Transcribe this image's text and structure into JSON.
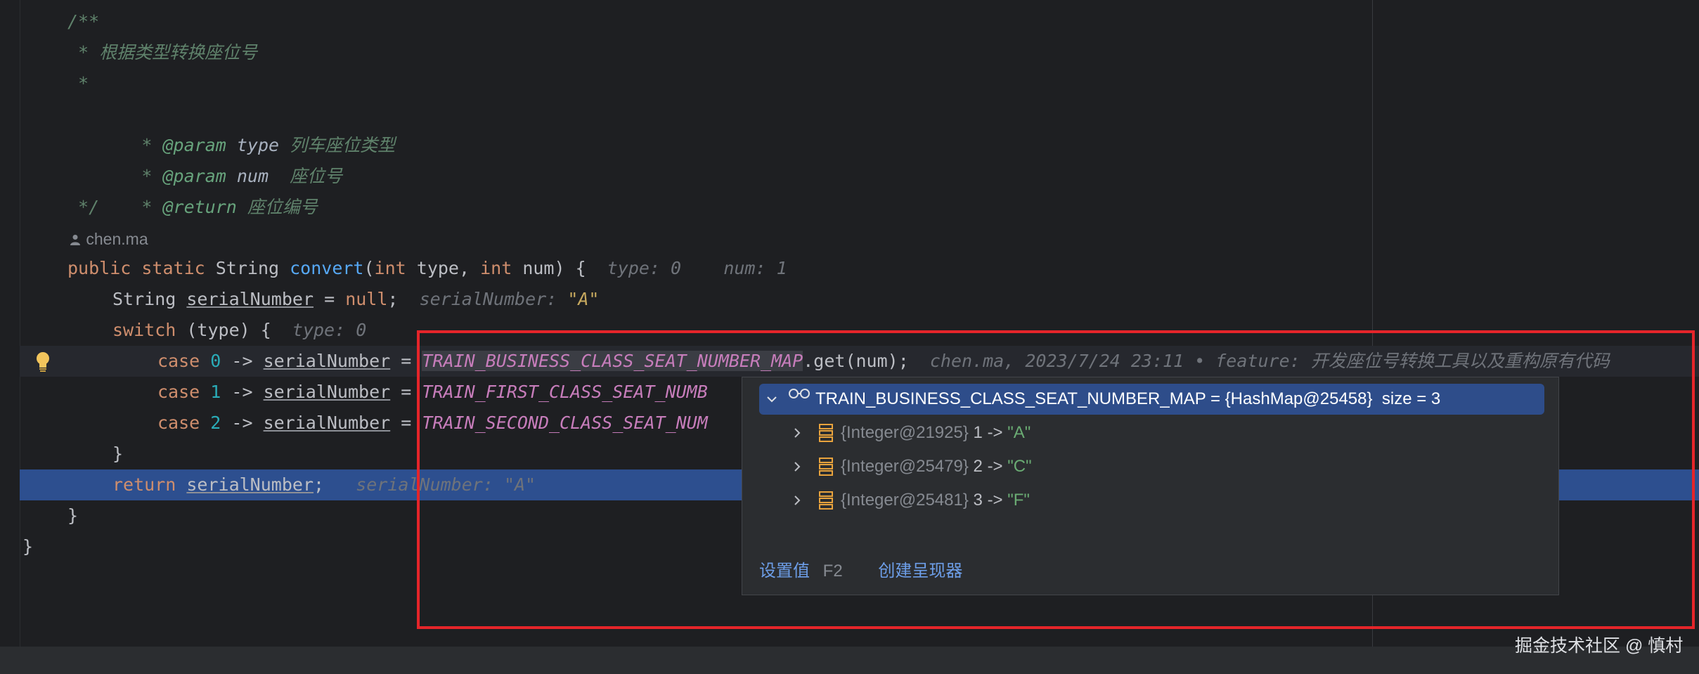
{
  "code": {
    "doc_open": "/**",
    "doc_desc": " * 根据类型转换座位号",
    "doc_blank": " *",
    "doc_param1_prefix": " * ",
    "doc_param1_tag": "@param",
    "doc_param1_name": "type",
    "doc_param1_desc": "列车座位类型",
    "doc_param2_prefix": " * ",
    "doc_param2_tag": "@param",
    "doc_param2_name": "num",
    "doc_param2_desc": "座位号",
    "doc_return_prefix": " * ",
    "doc_return_tag": "@return",
    "doc_return_desc": "座位编号",
    "doc_close": " */",
    "author": "chen.ma",
    "sig_public": "public",
    "sig_static": "static",
    "sig_type": "String",
    "sig_name": "convert",
    "sig_paren_open": "(",
    "sig_int1": "int",
    "sig_param1": "type,",
    "sig_int2": "int",
    "sig_param2": "num) {",
    "sig_hint1": "type: 0",
    "sig_hint2": "num: 1",
    "decl_type": "String",
    "decl_var": "serialNumber",
    "decl_eq": "=",
    "decl_null": "null",
    "decl_semi": ";",
    "decl_hint_label": "serialNumber:",
    "decl_hint_value": "\"A\"",
    "switch_kw": "switch",
    "switch_rest": "(type) {",
    "switch_hint": "type: 0",
    "case_kw": "case",
    "arrow": "->",
    "assign": "=",
    "case0_num": "0",
    "case1_num": "1",
    "case2_num": "2",
    "case_var": "serialNumber",
    "case0_field": "TRAIN_BUSINESS_CLASS_SEAT_NUMBER_MAP",
    "case0_call": ".get(num);",
    "case1_field": "TRAIN_FIRST_CLASS_SEAT_NUMB",
    "case2_field": "TRAIN_SECOND_CLASS_SEAT_NUM",
    "blame": "chen.ma, 2023/7/24 23:11 • feature: 开发座位号转换工具以及重构原有代码",
    "close_switch": "}",
    "return_kw": "return",
    "return_var": "serialNumber",
    "return_semi": ";",
    "return_hint_label": "serialNumber:",
    "return_hint_value": "\"A\"",
    "close_method": "}",
    "close_class": "}"
  },
  "debug_popup": {
    "root_name": "TRAIN_BUSINESS_CLASS_SEAT_NUMBER_MAP",
    "root_eq": "=",
    "root_value": "{HashMap@25458}",
    "root_size": "size = 3",
    "entries": [
      {
        "ref": "{Integer@21925}",
        "key": "1",
        "arrow": "->",
        "value": "\"A\""
      },
      {
        "ref": "{Integer@25479}",
        "key": "2",
        "arrow": "->",
        "value": "\"C\""
      },
      {
        "ref": "{Integer@25481}",
        "key": "3",
        "arrow": "->",
        "value": "\"F\""
      }
    ],
    "set_value_label": "设置值",
    "set_value_shortcut": "F2",
    "create_renderer_label": "创建呈现器"
  },
  "icons": {
    "bulb": "lightbulb-icon",
    "author": "user-icon",
    "watch": "glasses-icon",
    "expand": "chevron-right-icon",
    "collapse": "chevron-down-icon",
    "entry": "map-entry-icon"
  },
  "colors": {
    "highlight_box": "#e5252a",
    "exec_line": "#2d4f8f",
    "popup_bg": "#2b2d30"
  },
  "watermark": "掘金技术社区 @ 慎村"
}
